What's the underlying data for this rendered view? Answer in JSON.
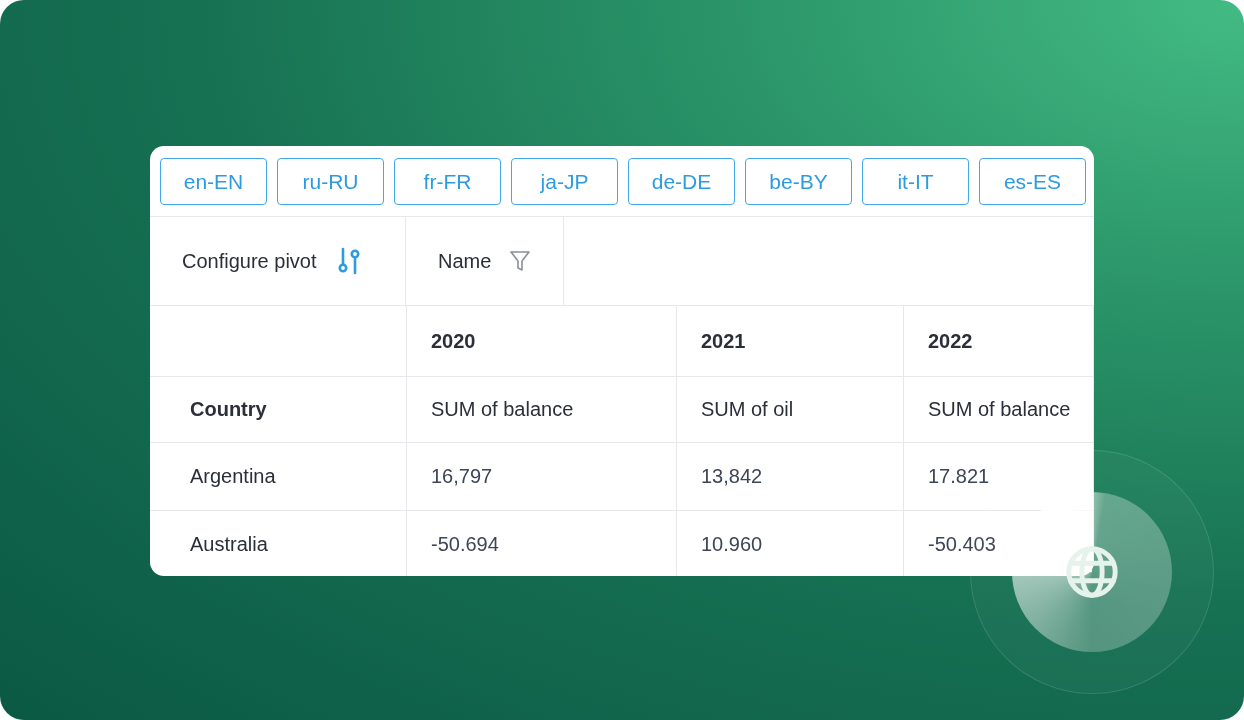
{
  "languages": [
    "en-EN",
    "ru-RU",
    "fr-FR",
    "ja-JP",
    "de-DE",
    "be-BY",
    "it-IT",
    "es-ES"
  ],
  "toolbar": {
    "configure_label": "Configure pivot",
    "filter_field": "Name"
  },
  "table": {
    "row_header": "Country",
    "columns": [
      {
        "year": "2020",
        "measure": "SUM of balance"
      },
      {
        "year": "2021",
        "measure": "SUM of oil"
      },
      {
        "year": "2022",
        "measure": "SUM of balance"
      }
    ],
    "rows": [
      {
        "name": "Argentina",
        "cells": [
          "16,797",
          "13,842",
          "17.821"
        ]
      },
      {
        "name": "Australia",
        "cells": [
          "-50.694",
          "10.960",
          "-50.403"
        ]
      }
    ]
  }
}
